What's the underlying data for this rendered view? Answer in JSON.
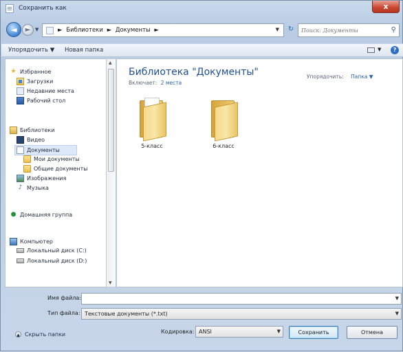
{
  "window": {
    "title": "Сохранить как",
    "close_glyph": "x"
  },
  "nav": {
    "back_glyph": "◄",
    "fwd_glyph": "►",
    "drop_glyph": "▼"
  },
  "address": {
    "crumbs": [
      "Библиотеки",
      "Документы"
    ],
    "sep": "►",
    "refresh_glyph": "↻"
  },
  "search": {
    "placeholder": "Поиск: Документы",
    "icon": "search-icon"
  },
  "toolbar": {
    "organize": "Упорядочить ▼",
    "new_folder": "Новая папка",
    "help": "?"
  },
  "sidebar": {
    "favorites": "Избранное",
    "downloads": "Загрузки",
    "recent": "Недавние места",
    "desktop": "Рабочий стол",
    "libraries": "Библиотеки",
    "video": "Видео",
    "documents": "Документы",
    "my_docs": "Мои документы",
    "public_docs": "Общие документы",
    "images": "Изображения",
    "music": "Музыка",
    "homegroup": "Домашняя группа",
    "computer": "Компьютер",
    "disk_c": "Локальный диск (C:)",
    "disk_d": "Локальный диск (D:)"
  },
  "content": {
    "library_title": "Библиотека \"Документы\"",
    "includes_label": "Включает:",
    "includes_link": "2 места",
    "arrange_label": "Упорядочить:",
    "arrange_value": "Папка ▼",
    "folders": [
      {
        "name": "5-класс"
      },
      {
        "name": "6-класс"
      }
    ]
  },
  "form": {
    "filename_label": "Имя файла:",
    "filename_value": "",
    "filetype_label": "Тип файла:",
    "filetype_value": "Текстовые документы (*.txt)",
    "hide_folders": "Скрыть папки",
    "encoding_label": "Кодировка:",
    "encoding_value": "ANSI",
    "save": "Сохранить",
    "cancel": "Отмена"
  }
}
